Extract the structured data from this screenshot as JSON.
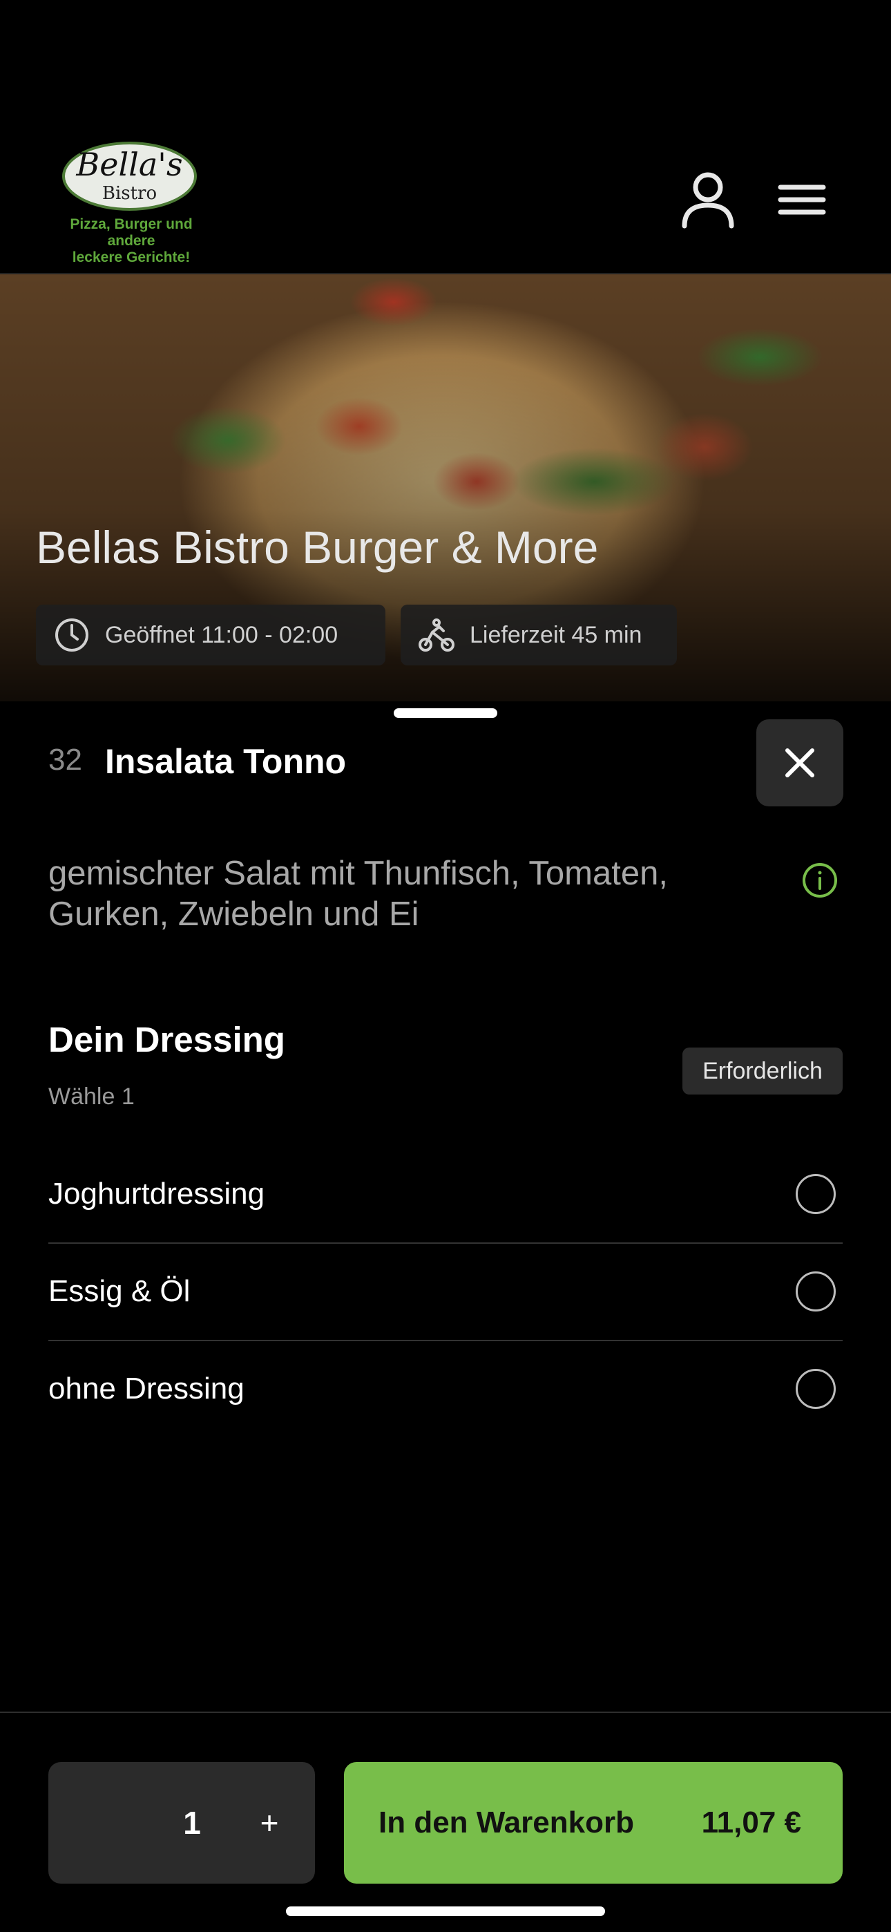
{
  "header": {
    "logo": {
      "title": "Bella's",
      "subtitle": "Bistro",
      "tagline_line1": "Pizza, Burger und andere",
      "tagline_line2": "leckere Gerichte!"
    },
    "icons": [
      "user-icon",
      "hamburger-menu-icon"
    ]
  },
  "hero": {
    "title": "Bellas Bistro Burger & More",
    "opening": "Geöffnet 11:00 - 02:00",
    "delivery": "Lieferzeit 45 min"
  },
  "item": {
    "number": "32",
    "title": "Insalata Tonno",
    "description": "gemischter Salat mit Thunfisch, Tomaten, Gurken, Zwiebeln und Ei"
  },
  "dressing": {
    "title": "Dein Dressing",
    "subtitle": "Wähle 1",
    "badge": "Erforderlich",
    "options": [
      {
        "label": "Joghurtdressing"
      },
      {
        "label": "Essig & Öl"
      },
      {
        "label": "ohne Dressing"
      }
    ]
  },
  "footer": {
    "quantity": "1",
    "plus": "+",
    "cart_label": "In den Warenkorb",
    "price": "11,07 €"
  },
  "colors": {
    "accent": "#78be4a",
    "background": "#000000",
    "surface": "#2b2b2b"
  }
}
